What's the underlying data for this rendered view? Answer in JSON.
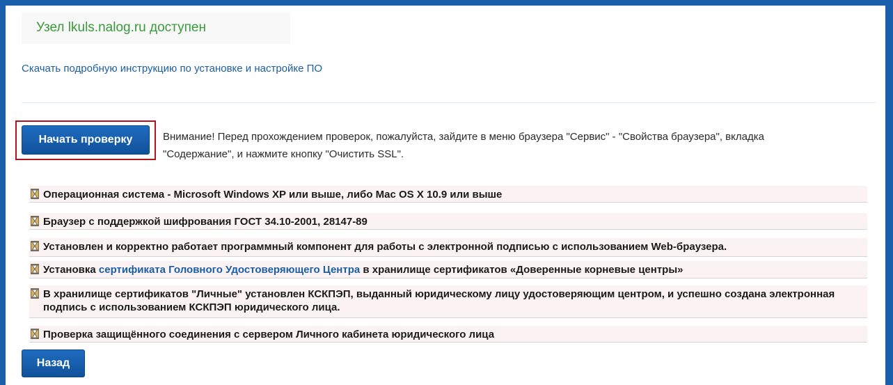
{
  "status": {
    "text": "Узел lkuls.nalog.ru доступен",
    "color": "#3a9a3a"
  },
  "download_link": "Скачать подробную инструкцию по установке и настройке ПО",
  "start_button_label": "Начать проверку",
  "warning_text": "Внимание! Перед прохождением проверок, пожалуйста, зайдите в меню браузера \"Сервис\" - \"Свойства браузера\", вкладка \"Содержание\", и нажмите кнопку \"Очистить SSL\".",
  "checks": [
    {
      "icon": "hourglass-icon",
      "text": "Операционная система - Microsoft Windows XP или выше, либо Mac OS X 10.9 или выше"
    },
    {
      "icon": "hourglass-icon",
      "text": "Браузер с поддержкой шифрования ГОСТ 34.10-2001, 28147-89"
    },
    {
      "icon": "hourglass-icon",
      "text": "Установлен и корректно работает программный компонент для работы с электронной подписью с использованием Web-браузера."
    },
    {
      "icon": "hourglass-icon",
      "prefix": "Установка ",
      "link": "сертификата Головного Удостоверяющего Центра",
      "suffix": " в хранилище сертификатов «Доверенные корневые центры»"
    },
    {
      "icon": "hourglass-icon",
      "text": "В хранилище сертификатов \"Личные\" установлен КСКПЭП, выданный юридическому лицу удостоверяющим центром, и успешно создана электронная подпись с использованием КСКПЭП юридического лица."
    },
    {
      "icon": "hourglass-icon",
      "text": "Проверка защищённого соединения с сервером Личного кабинета юридического лица"
    }
  ],
  "back_button_label": "Назад",
  "colors": {
    "outer_border": "#1a5faa",
    "accent_button": "#1660b0",
    "link": "#1c5ea3",
    "highlight_border": "#b3141b",
    "check_row_bg": "#fbf3f3"
  }
}
